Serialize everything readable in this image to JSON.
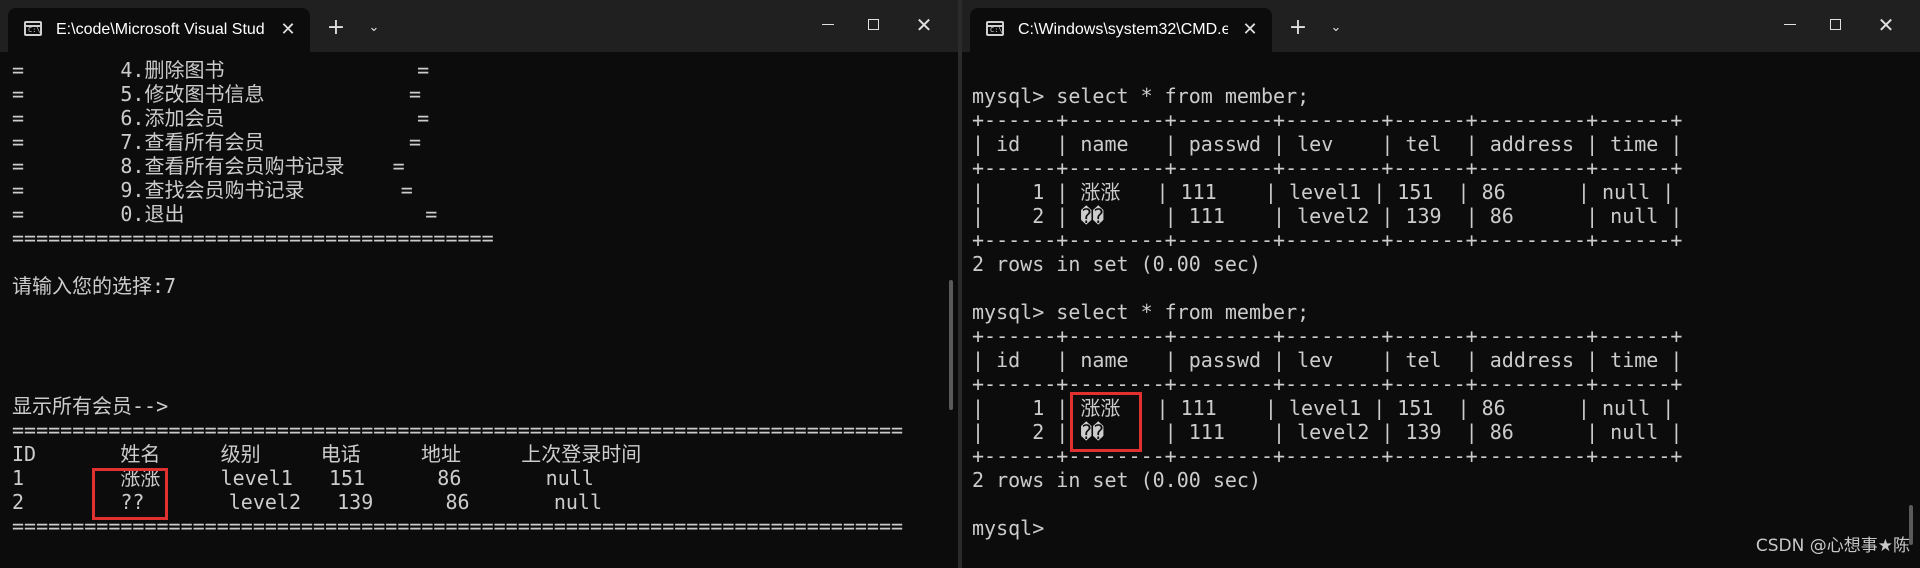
{
  "left_window": {
    "tab_title": "E:\\code\\Microsoft Visual Stud",
    "console_lines": [
      "=        4.删除图书                =",
      "=        5.修改图书信息            =",
      "=        6.添加会员                =",
      "=        7.查看所有会员            =",
      "=        8.查看所有会员购书记录    =",
      "=        9.查找会员购书记录        =",
      "=        0.退出                    =",
      "========================================",
      "",
      "请输入您的选择:7",
      "",
      "",
      "",
      "",
      "显示所有会员-->",
      "==========================================================================",
      "ID       姓名     级别     电话     地址     上次登录时间",
      "1        涨涨     level1   151      86       null",
      "2        ??       level2   139      86       null",
      "=========================================================================="
    ]
  },
  "right_window": {
    "tab_title": "C:\\Windows\\system32\\CMD.e",
    "console_lines": [
      "mysql> select * from member;",
      "+------+--------+--------+--------+------+---------+------+",
      "| id   | name   | passwd | lev    | tel  | address | time |",
      "+------+--------+--------+--------+------+---------+------+",
      "|    1 | 涨涨   | 111    | level1 | 151  | 86      | null |",
      "|    2 | ��     | 111    | level2 | 139  | 86      | null |",
      "+------+--------+--------+--------+------+---------+------+",
      "2 rows in set (0.00 sec)",
      "",
      "mysql> select * from member;",
      "+------+--------+--------+--------+------+---------+------+",
      "| id   | name   | passwd | lev    | tel  | address | time |",
      "+------+--------+--------+--------+------+---------+------+",
      "|    1 | 涨涨   | 111    | level1 | 151  | 86      | null |",
      "|    2 | ��     | 111    | level2 | 139  | 86      | null |",
      "+------+--------+--------+--------+------+---------+------+",
      "2 rows in set (0.00 sec)",
      "",
      "mysql>"
    ]
  },
  "controls": {
    "tab_close": "✕",
    "new_tab": "+",
    "dropdown": "⌄",
    "window_close": "✕",
    "tab_icon_text": "C:\\"
  },
  "icons": {
    "terminal": "terminal-icon",
    "highlight": "red-box"
  },
  "colors": {
    "terminal_bg": "#0c0c0c",
    "terminal_text": "#cccccc",
    "highlight": "#e03030"
  },
  "watermark": "CSDN @心想事★陈"
}
